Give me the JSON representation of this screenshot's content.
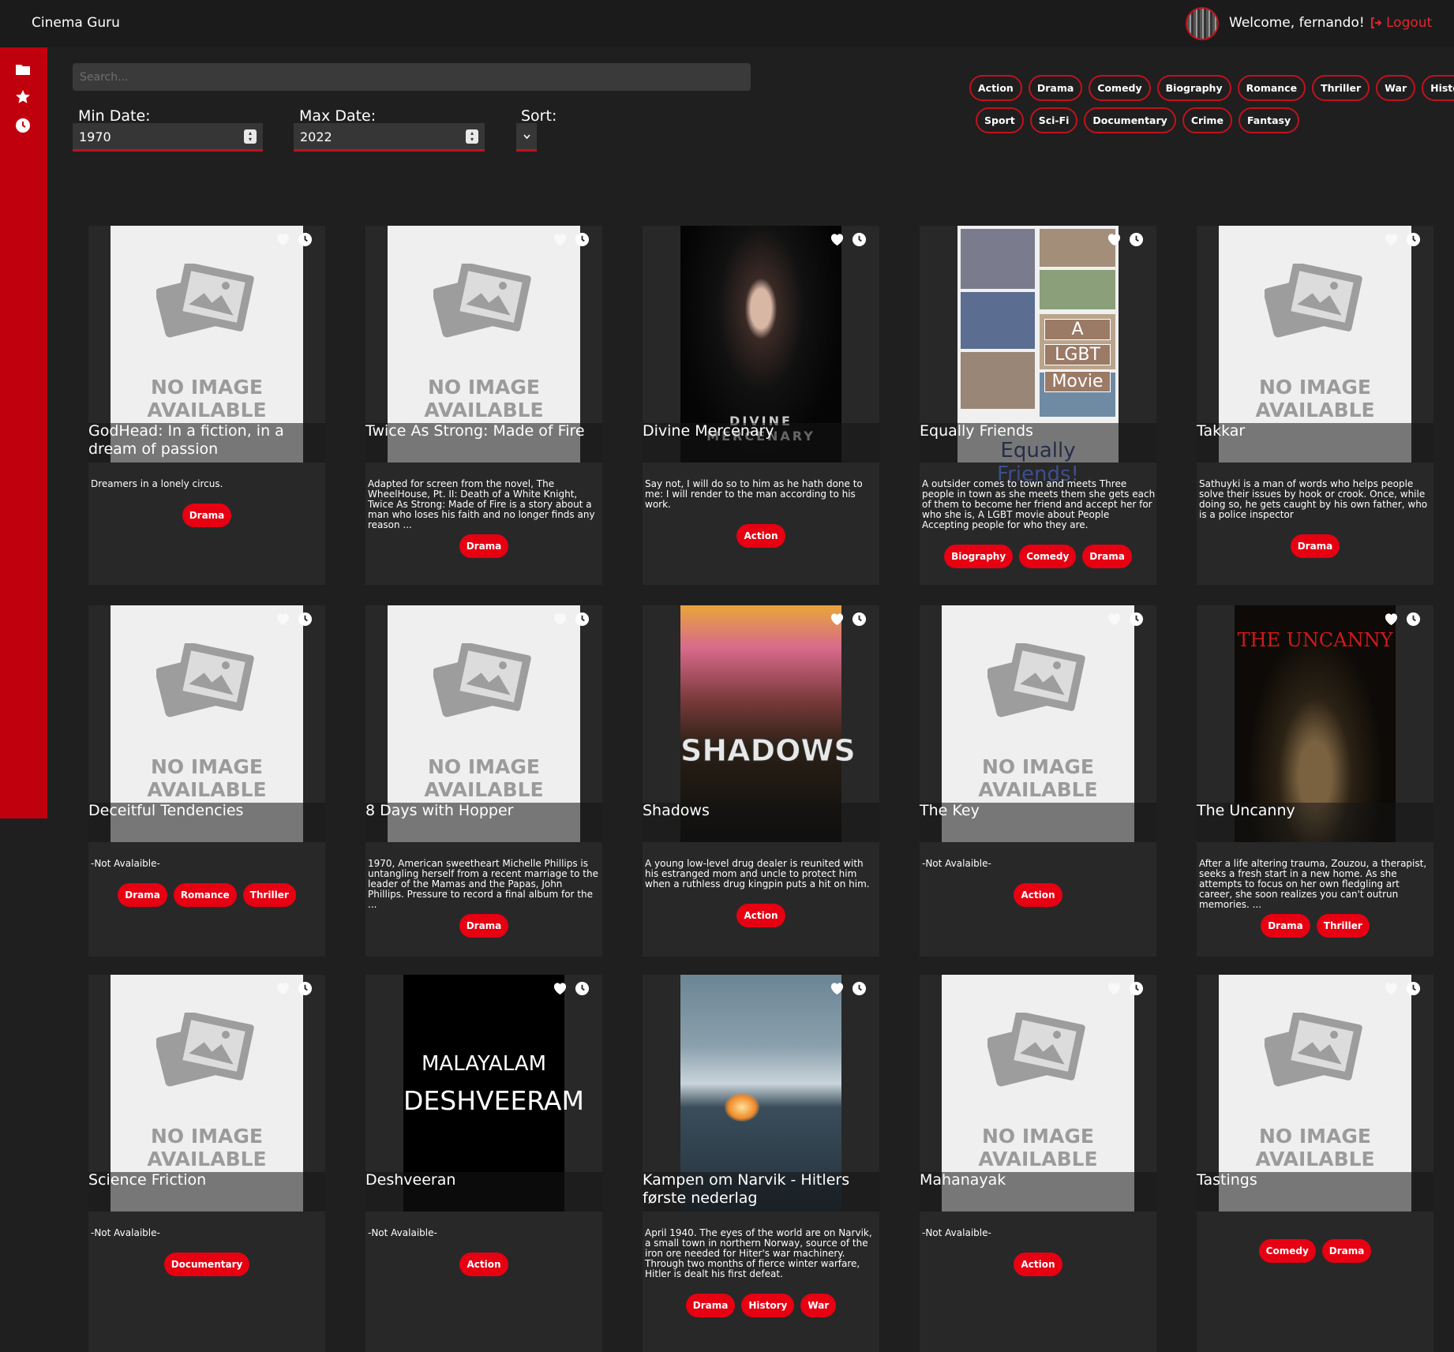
{
  "app": {
    "title": "Cinema Guru"
  },
  "header": {
    "welcome": "Welcome, fernando!",
    "logout_label": "Logout"
  },
  "sidebar": {
    "icons": [
      "folder-icon",
      "star-icon",
      "clock-icon"
    ]
  },
  "filters": {
    "search_placeholder": "Search...",
    "min_date_label": "Min Date:",
    "min_date_value": "1970",
    "max_date_label": "Max Date:",
    "max_date_value": "2022",
    "sort_label": "Sort:"
  },
  "genres": {
    "row1": [
      "Action",
      "Drama",
      "Comedy",
      "Biography",
      "Romance",
      "Thriller",
      "War",
      "History"
    ],
    "row2": [
      "Sport",
      "Sci-Fi",
      "Documentary",
      "Crime",
      "Fantasy"
    ]
  },
  "no_image": {
    "line1": "NO IMAGE",
    "line2": "AVAILABLE"
  },
  "movies": [
    {
      "title": "GodHead: In a fiction, in a dream of passion",
      "synopsis": "Dreamers in a lonely circus.",
      "tags": [
        "Drama"
      ],
      "poster": "none"
    },
    {
      "title": "Twice As Strong: Made of Fire",
      "synopsis": "Adapted for screen from the novel, The WheelHouse, Pt. II: Death of a White Knight, Twice As Strong: Made of Fire is a story about a man who loses his faith and no longer finds any reason ...",
      "tags": [
        "Drama"
      ],
      "poster": "none"
    },
    {
      "title": "Divine Mercenary",
      "synopsis": "Say not, I will do so to him as he hath done to me: I will render to the man according to his work.",
      "tags": [
        "Action"
      ],
      "poster": "divine",
      "poster_text": "DIVINE MERCENARY"
    },
    {
      "title": "Equally Friends",
      "synopsis": "A outsider comes to town and meets Three people in town as she meets them she gets each of them to become her friend and accept her for who she is, A LGBT movie about People Accepting people for who they are.",
      "tags": [
        "Biography",
        "Comedy",
        "Drama"
      ],
      "poster": "equally",
      "poster_text": [
        "A",
        "LGBT",
        "Movie",
        "Equally Friends!"
      ]
    },
    {
      "title": "Takkar",
      "synopsis": "Sathuyki is a man of words who helps people solve their issues by hook or crook. Once, while doing so, he gets caught by his own father, who is a police inspector",
      "tags": [
        "Drama"
      ],
      "poster": "none"
    },
    {
      "title": "Deceitful Tendencies",
      "synopsis": "-Not Avalaible-",
      "tags": [
        "Drama",
        "Romance",
        "Thriller"
      ],
      "poster": "none"
    },
    {
      "title": "8 Days with Hopper",
      "synopsis": "1970, American sweetheart Michelle Phillips is untangling herself from a recent marriage to the leader of the Mamas and the Papas, John Phillips. Pressure to record a final album for the ...",
      "tags": [
        "Drama"
      ],
      "poster": "none"
    },
    {
      "title": "Shadows",
      "synopsis": "A young low-level drug dealer is reunited with his estranged mom and uncle to protect him when a ruthless drug kingpin puts a hit on him.",
      "tags": [
        "Action"
      ],
      "poster": "shadows",
      "poster_text": "SHADOWS"
    },
    {
      "title": "The Key",
      "synopsis": "-Not Avalaible-",
      "tags": [
        "Action"
      ],
      "poster": "none"
    },
    {
      "title": "The Uncanny",
      "synopsis": "After a life altering trauma, Zouzou, a therapist, seeks a fresh start in a new home. As she attempts to focus on her own fledgling art career, she soon realizes you can't outrun memories. ...",
      "tags": [
        "Drama",
        "Thriller"
      ],
      "poster": "uncanny",
      "poster_text": "THE UNCANNY"
    },
    {
      "title": "Science Friction",
      "synopsis": "-Not Avalaible-",
      "tags": [
        "Documentary"
      ],
      "poster": "none"
    },
    {
      "title": "Deshveeran",
      "synopsis": "-Not Avalaible-",
      "tags": [
        "Action"
      ],
      "poster": "deshveeran",
      "poster_text": [
        "MALAYALAM",
        "DESHVEERAM"
      ]
    },
    {
      "title": "Kampen om Narvik - Hitlers første nederlag",
      "synopsis": "April 1940. The eyes of the world are on Narvik, a small town in northern Norway, source of the iron ore needed for Hiter's war machinery. Through two months of fierce winter warfare, Hitler is dealt his first defeat.",
      "tags": [
        "Drama",
        "History",
        "War"
      ],
      "poster": "narvik"
    },
    {
      "title": "Mahanayak",
      "synopsis": "-Not Avalaible-",
      "tags": [
        "Action"
      ],
      "poster": "none"
    },
    {
      "title": "Tastings",
      "synopsis": "",
      "tags": [
        "Comedy",
        "Drama"
      ],
      "poster": "none"
    }
  ],
  "colors": {
    "accent": "#c0000d",
    "tag": "#e60012",
    "bg": "#1f1f1f",
    "card": "#282828"
  }
}
